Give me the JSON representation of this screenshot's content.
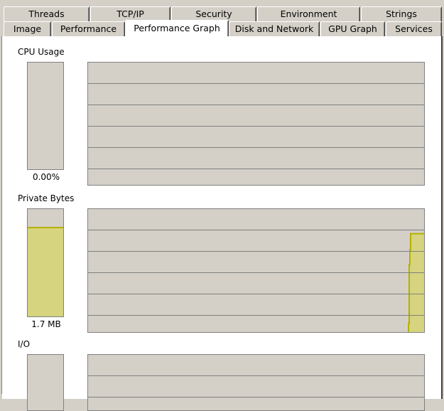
{
  "tabs": {
    "row1": [
      {
        "label": "Threads"
      },
      {
        "label": "TCP/IP"
      },
      {
        "label": "Security"
      },
      {
        "label": "Environment"
      },
      {
        "label": "Strings"
      }
    ],
    "row2": [
      {
        "label": "Image"
      },
      {
        "label": "Performance"
      },
      {
        "label": "Performance Graph",
        "selected": true
      },
      {
        "label": "Disk and Network"
      },
      {
        "label": "GPU Graph"
      },
      {
        "label": "Services"
      }
    ]
  },
  "sections": {
    "cpu": {
      "label": "CPU Usage",
      "value": "0.00%",
      "meter_fraction": 0.0,
      "history": []
    },
    "private_bytes": {
      "label": "Private Bytes",
      "value": "1.7 MB",
      "meter_fraction": 0.82,
      "history_recent_fraction": 0.8
    },
    "io": {
      "label": "I/O"
    }
  },
  "colors": {
    "graph_bg": "#d4d0c8",
    "grid": "#808080",
    "memory_fill": "#d6d47e",
    "memory_line": "#b5b000"
  }
}
